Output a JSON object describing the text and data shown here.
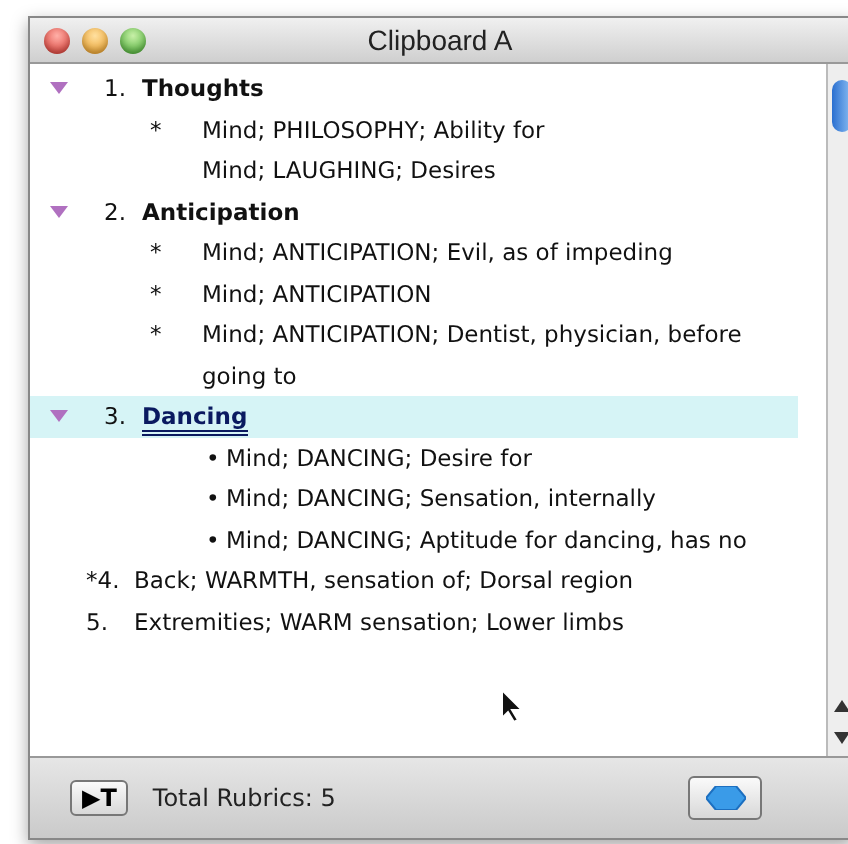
{
  "window": {
    "title": "Clipboard A"
  },
  "rubrics": [
    {
      "kind": "group",
      "number": "1.",
      "title": "Thoughts",
      "expanded": true,
      "selected": false,
      "entries": [
        {
          "marker": "*",
          "text": "Mind; PHILOSOPHY; Ability for"
        },
        {
          "text": "Mind; LAUGHING; Desires"
        }
      ]
    },
    {
      "kind": "group",
      "number": "2.",
      "title": "Anticipation",
      "expanded": true,
      "selected": false,
      "entries": [
        {
          "marker": "*",
          "text": "Mind; ANTICIPATION; Evil, as of impeding"
        },
        {
          "marker": "*",
          "text": "Mind; ANTICIPATION"
        },
        {
          "marker": "*",
          "text": "Mind; ANTICIPATION; Dentist, physician, before going to"
        }
      ]
    },
    {
      "kind": "group",
      "number": "3.",
      "title": "Dancing",
      "expanded": true,
      "selected": true,
      "entries": [
        {
          "marker": "•",
          "text": "Mind; DANCING; Desire for"
        },
        {
          "marker": "•",
          "text": "Mind; DANCING; Sensation, internally"
        },
        {
          "marker": "•",
          "text": "Mind; DANCING; Aptitude for dancing, has no"
        }
      ]
    },
    {
      "kind": "plain",
      "number": "*4.",
      "title": "Back; WARMTH, sensation of; Dorsal region"
    },
    {
      "kind": "plain",
      "number": "5.",
      "title": "Extremities; WARM sensation; Lower limbs"
    }
  ],
  "status_bar": {
    "button": "▶T",
    "total": "Total Rubrics: 5"
  }
}
